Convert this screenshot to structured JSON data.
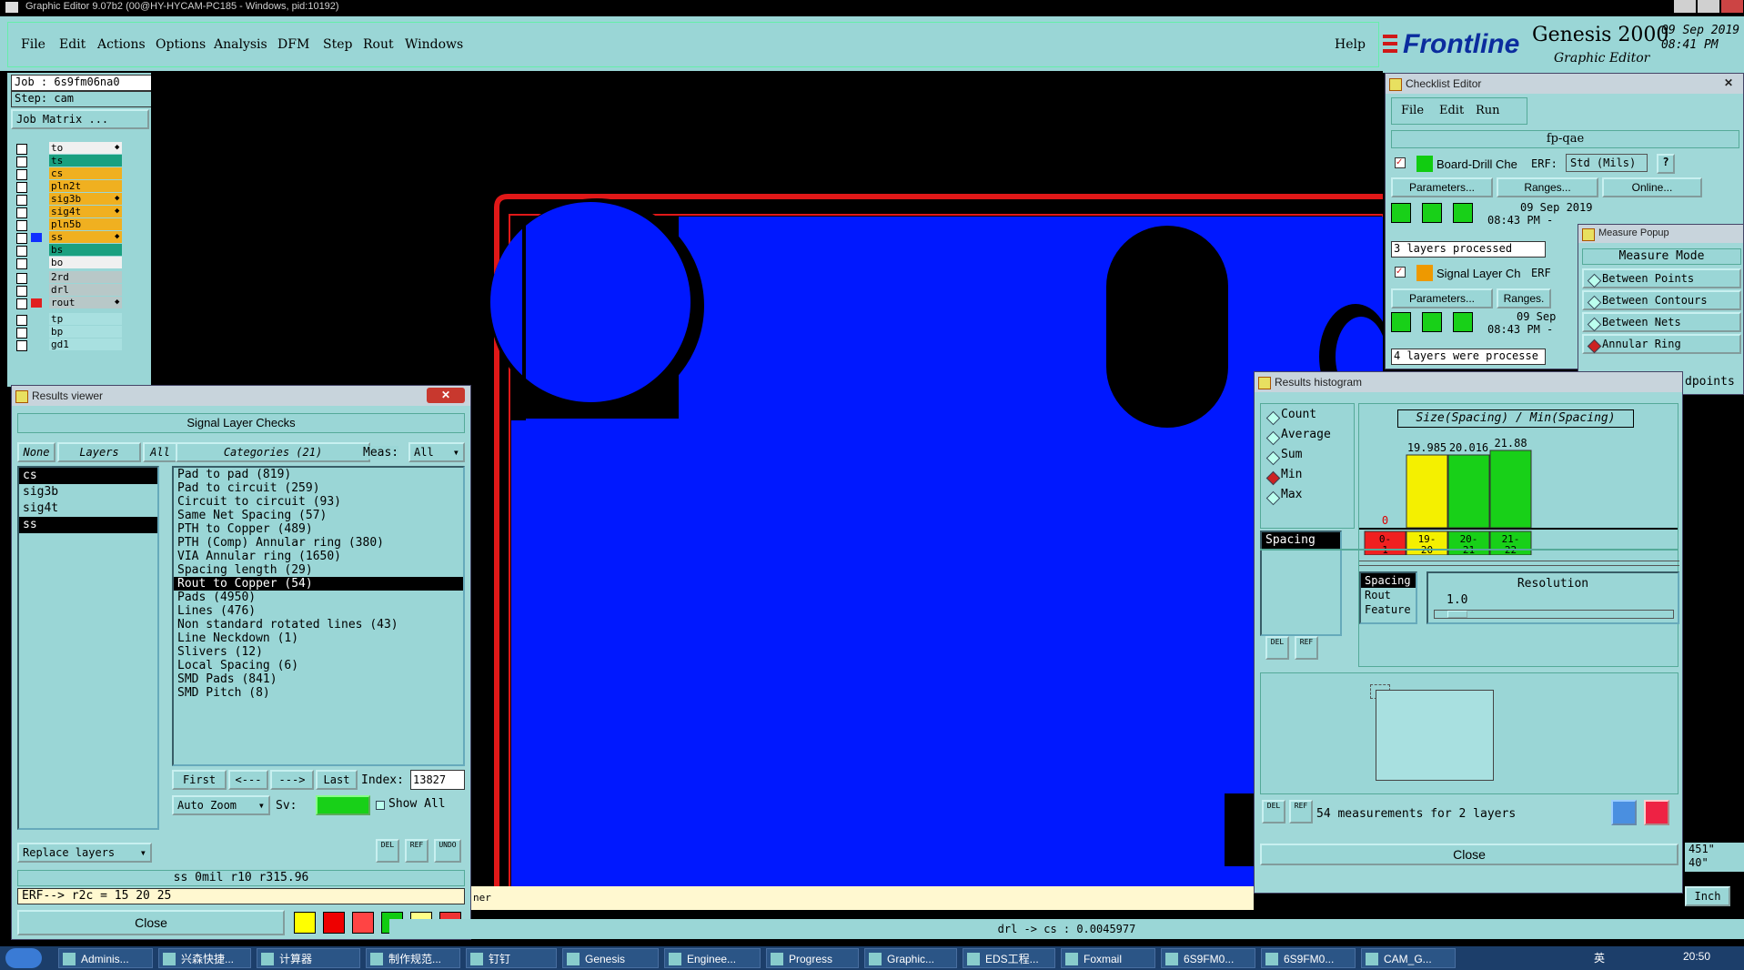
{
  "window": {
    "title": "Graphic Editor 9.07b2 (00@HY-HYCAM-PC185 - Windows, pid:10192)"
  },
  "menu": [
    "File",
    "Edit",
    "Actions",
    "Options",
    "Analysis",
    "DFM",
    "Step",
    "Rout",
    "Windows"
  ],
  "help": "Help",
  "brand": {
    "logo": "Frontline",
    "product": "Genesis 2000",
    "subtitle": "Graphic Editor",
    "date": "09 Sep 2019",
    "time": "08:41 PM"
  },
  "job": {
    "job_label": "Job : 6s9fm06na0",
    "step_label": "Step: cam",
    "matrix_button": "Job Matrix ..."
  },
  "layers": [
    {
      "name": "to",
      "color": "#f0f0f0",
      "swatch": "",
      "mark": true
    },
    {
      "name": "ts",
      "color": "#1aa080",
      "swatch": "",
      "mark": false
    },
    {
      "name": "cs",
      "color": "#f0b020",
      "swatch": "",
      "mark": false
    },
    {
      "name": "pln2t",
      "color": "#f0b020",
      "swatch": "",
      "mark": false
    },
    {
      "name": "sig3b",
      "color": "#f0b020",
      "swatch": "",
      "mark": true
    },
    {
      "name": "sig4t",
      "color": "#f0b020",
      "swatch": "",
      "mark": true
    },
    {
      "name": "pln5b",
      "color": "#f0b020",
      "swatch": "",
      "mark": false
    },
    {
      "name": "ss",
      "color": "#f0b020",
      "swatch": "#1030ff",
      "mark": true
    },
    {
      "name": "bs",
      "color": "#1aa080",
      "swatch": "",
      "mark": false
    },
    {
      "name": "bo",
      "color": "#f0f0f0",
      "swatch": "",
      "mark": false
    },
    {
      "name": "2rd",
      "color": "#b8c8c8",
      "swatch": "",
      "mark": false
    },
    {
      "name": "drl",
      "color": "#b8c8c8",
      "swatch": "",
      "mark": false
    },
    {
      "name": "rout",
      "color": "#b8c8c8",
      "swatch": "#e02020",
      "mark": true
    },
    {
      "name": "tp",
      "color": "#a8e0e0",
      "swatch": "",
      "mark": false
    },
    {
      "name": "bp",
      "color": "#a8e0e0",
      "swatch": "",
      "mark": false
    },
    {
      "name": "gd1",
      "color": "#a8e0e0",
      "swatch": "",
      "mark": false
    }
  ],
  "results_viewer": {
    "title": "Results viewer",
    "header": "Signal Layer Checks",
    "none_btn": "None",
    "layers_btn": "Layers",
    "all_btn": "All",
    "categories_label": "Categories (21)",
    "meas_label": "Meas:",
    "meas_value": "All",
    "layer_list": [
      {
        "name": "cs",
        "sel": true
      },
      {
        "name": "sig3b",
        "sel": false
      },
      {
        "name": "sig4t",
        "sel": false
      },
      {
        "name": "ss",
        "sel": true
      }
    ],
    "categories": [
      "Pad to pad (819)",
      "Pad to circuit (259)",
      "Circuit to circuit (93)",
      "Same Net Spacing (57)",
      "PTH to Copper (489)",
      "PTH (Comp) Annular ring (380)",
      "VIA Annular ring (1650)",
      "Spacing length (29)",
      "Rout to Copper (54)",
      "Pads (4950)",
      "Lines (476)",
      "Non standard rotated lines (43)",
      "Line Neckdown (1)",
      "Slivers (12)",
      "Local Spacing (6)",
      "SMD Pads (841)",
      "SMD Pitch (8)"
    ],
    "selected_category": 8,
    "first": "First",
    "prev": "<---",
    "next": "--->",
    "last": "Last",
    "index_label": "Index:",
    "index_value": "13827",
    "auto_zoom": "Auto Zoom",
    "sv_label": "Sv:",
    "show_all": "Show All",
    "replace_layers": "Replace layers",
    "status1": "ss  0mil   r10   r315.96",
    "status2": "ERF--> r2c = 15 20 25",
    "close": "Close",
    "del": "DEL",
    "ref": "REF",
    "undo": "UNDO"
  },
  "checklist": {
    "title": "Checklist Editor",
    "menu": [
      "File",
      "Edit",
      "Run"
    ],
    "name": "fp-qae",
    "item1": {
      "name": "Board-Drill Che",
      "erf": "ERF:",
      "std": "Std (Mils)",
      "params": "Parameters...",
      "ranges": "Ranges...",
      "online": "Online...",
      "date": "09 Sep 2019",
      "time": "08:43 PM -",
      "status": "3 layers processed"
    },
    "item2": {
      "name": "Signal Layer Ch",
      "erf": "ERF",
      "params": "Parameters...",
      "ranges": "Ranges.",
      "date": "09 Sep",
      "time": "08:43 PM -",
      "status": "4 layers were processe"
    }
  },
  "measure": {
    "title": "Measure Popup",
    "header": "Measure Mode",
    "modes": [
      {
        "label": "Between Points",
        "on": false
      },
      {
        "label": "Between Contours",
        "on": false
      },
      {
        "label": "Between Nets",
        "on": false
      },
      {
        "label": "Annular Ring",
        "on": true
      }
    ],
    "extra": "dpoints",
    "readout": [
      "451\"",
      "40\""
    ],
    "units": "Inch"
  },
  "histogram": {
    "title": "Results histogram",
    "stats": [
      {
        "label": "Count",
        "on": false
      },
      {
        "label": "Average",
        "on": false
      },
      {
        "label": "Sum",
        "on": false
      },
      {
        "label": "Min",
        "on": true
      },
      {
        "label": "Max",
        "on": false
      }
    ],
    "chart_title": "Size(Spacing) / Min(Spacing)",
    "bars": [
      {
        "range": "0-\n1",
        "value": "0",
        "count": 0,
        "fill": "#f02020"
      },
      {
        "range": "19-\n20",
        "value": "19.985",
        "count": 0.8,
        "fill": "#f4f000"
      },
      {
        "range": "20-\n21",
        "value": "20.016",
        "count": 0.8,
        "fill": "#18d018"
      },
      {
        "range": "21-\n22",
        "value": "21.88",
        "count": 0.85,
        "fill": "#18d018"
      }
    ],
    "list_left": [
      "Spacing"
    ],
    "list_bottom": [
      {
        "name": "Spacing",
        "sel": true
      },
      {
        "name": "Rout",
        "sel": false
      },
      {
        "name": "Feature",
        "sel": false
      }
    ],
    "resolution_label": "Resolution",
    "resolution_value": "1.0",
    "measurements": "54 measurements for 2 layers",
    "close": "Close",
    "del": "DEL",
    "ref": "REF"
  },
  "status": {
    "left": "ner",
    "center": "drl -> cs : 0.0045977"
  },
  "taskbar": {
    "items": [
      "Adminis...",
      "兴森快捷...",
      "计算器",
      "制作规范...",
      "钉钉",
      "Genesis",
      "Enginee...",
      "Progress",
      "Graphic...",
      "EDS工程...",
      "Foxmail",
      "6S9FM0...",
      "6S9FM0...",
      "CAM_G..."
    ],
    "clock": "20:50",
    "ime": "英"
  }
}
